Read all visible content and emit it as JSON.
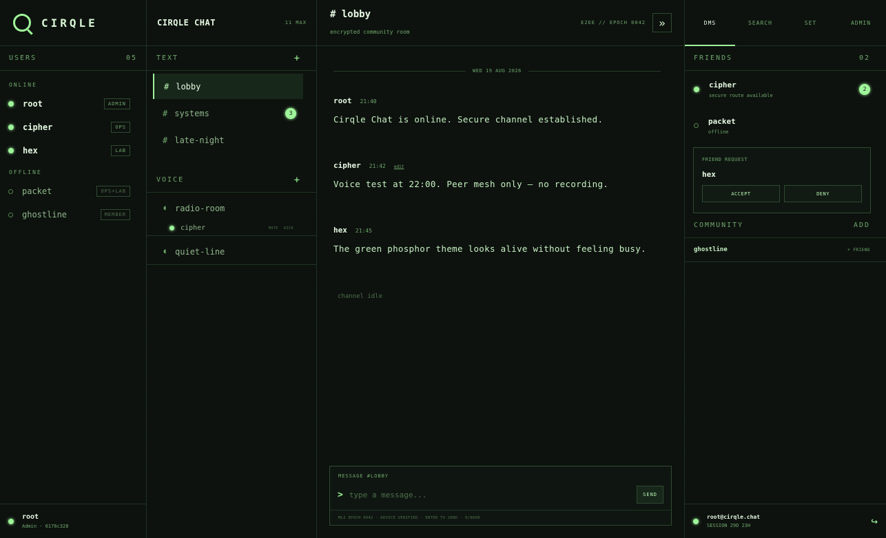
{
  "app": {
    "logo": "CIRQLE"
  },
  "users": {
    "heading": "USERS",
    "count": "05",
    "online_label": "ONLINE",
    "offline_label": "OFFLINE",
    "online": [
      {
        "name": "root",
        "role": "ADMIN"
      },
      {
        "name": "cipher",
        "role": "OPS"
      },
      {
        "name": "hex",
        "role": "LAB"
      }
    ],
    "offline": [
      {
        "name": "packet",
        "role": "OPS+LAB"
      },
      {
        "name": "ghostline",
        "role": "MEMBER"
      }
    ],
    "self": {
      "name": "root",
      "sub": "Admin · 6176c328"
    }
  },
  "channels": {
    "title": "CIRQLE CHAT",
    "max": "11 MAX",
    "text_heading": "TEXT",
    "voice_heading": "VOICE",
    "add_symbol": "+",
    "text": [
      {
        "hash": "#",
        "name": "lobby",
        "unread": ""
      },
      {
        "hash": "#",
        "name": "systems",
        "unread": "3"
      },
      {
        "hash": "#",
        "name": "late-night",
        "unread": ""
      }
    ],
    "voice": [
      {
        "name": "radio-room"
      },
      {
        "name": "quiet-line"
      }
    ],
    "voice_member": {
      "name": "cipher",
      "mute": "MUTE",
      "kick": "KICK"
    }
  },
  "main": {
    "room": "# lobby",
    "subtitle": "encrypted community room",
    "epoch": "E2EE // EPOCH 0042",
    "collapse_glyph": "»",
    "date": "WED 19 AUG 2026",
    "messages": [
      {
        "author": "root",
        "time": "21:40",
        "edit": "",
        "body": "Cirqle Chat is online. Secure channel established."
      },
      {
        "author": "cipher",
        "time": "21:42",
        "edit": "edit",
        "body": "Voice test at 22:00. Peer mesh only — no recording."
      },
      {
        "author": "hex",
        "time": "21:45",
        "edit": "",
        "body": "The green phosphor theme looks alive without feeling busy."
      }
    ],
    "idle": "channel idle",
    "composer": {
      "label": "MESSAGE #LOBBY",
      "prompt": ">",
      "placeholder": "type a message...",
      "send": "SEND",
      "footer": "MLS EPOCH 0042 · DEVICE VERIFIED · ENTER TO SEND · 0/8000"
    }
  },
  "right": {
    "tabs": [
      "DMS",
      "SEARCH",
      "SET",
      "ADMIN"
    ],
    "friends_heading": "FRIENDS",
    "friends_count": "02",
    "friends": [
      {
        "name": "cipher",
        "status": "secure route available",
        "badge": "2"
      },
      {
        "name": "packet",
        "status": "offline",
        "badge": ""
      }
    ],
    "request": {
      "label": "FRIEND REQUEST",
      "name": "hex",
      "accept": "ACCEPT",
      "deny": "DENY"
    },
    "community_heading": "COMMUNITY",
    "community_add": "ADD",
    "community": [
      {
        "name": "ghostline",
        "action": "+ FRIEND"
      }
    ],
    "account": {
      "name": "root@cirqle.chat",
      "session": "SESSION 29D 23H",
      "logout_glyph": "↪"
    }
  },
  "colors": {
    "accent": "#9ff59a",
    "background": "#0c110d",
    "border": "#1f3322"
  }
}
